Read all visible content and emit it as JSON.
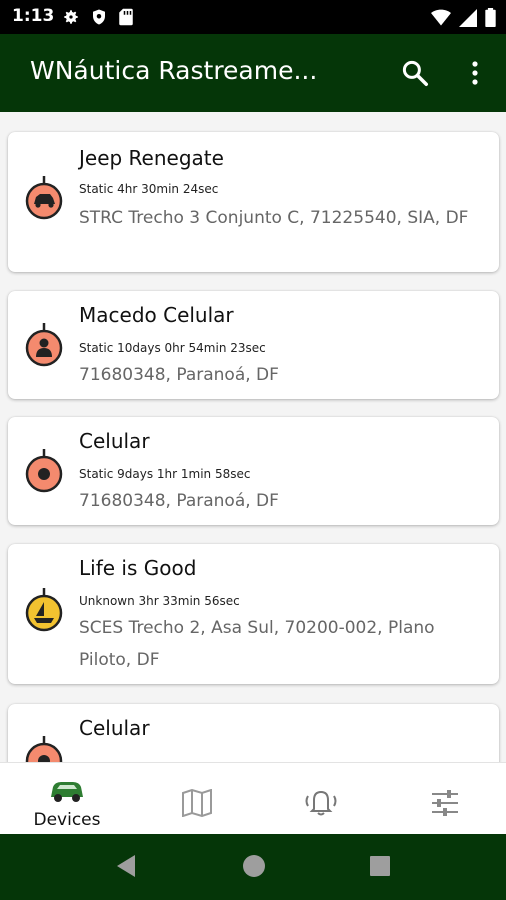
{
  "status_bar": {
    "time": "1:13"
  },
  "app_bar": {
    "title": "WNáutica Rastreame..."
  },
  "devices": [
    {
      "name": "Jeep Renegate",
      "status": "Static 4hr 30min 24sec",
      "address": "STRC Trecho 3 Conjunto C, 71225540, SIA, DF",
      "icon": "car-icon",
      "color": "#f48a6e"
    },
    {
      "name": "Macedo Celular",
      "status": "Static 10days 0hr 54min 23sec",
      "address": "71680348, Paranoá, DF",
      "icon": "person-icon",
      "color": "#f48a6e"
    },
    {
      "name": "Celular",
      "status": "Static 9days 1hr 1min 58sec",
      "address": "71680348, Paranoá, DF",
      "icon": "dot-icon",
      "color": "#f48a6e"
    },
    {
      "name": "Life is Good",
      "status": "Unknown 3hr 33min 56sec",
      "address": "SCES Trecho 2, Asa Sul, 70200-002, Plano Piloto, DF",
      "icon": "boat-icon",
      "color": "#f2c230"
    },
    {
      "name": "Celular",
      "status": "",
      "address": "",
      "icon": "dot-icon",
      "color": "#f48a6e"
    }
  ],
  "bottom_nav": [
    {
      "label": "Devices",
      "icon": "car-icon",
      "active": true
    },
    {
      "label": "",
      "icon": "map-icon",
      "active": false
    },
    {
      "label": "",
      "icon": "bell-icon",
      "active": false
    },
    {
      "label": "",
      "icon": "sliders-icon",
      "active": false
    }
  ],
  "colors": {
    "primary": "#053608",
    "marker_red": "#f48a6e",
    "marker_yellow": "#f2c230"
  }
}
